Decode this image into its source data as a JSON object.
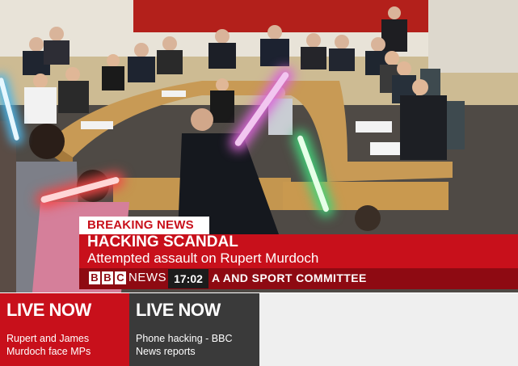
{
  "breaking": {
    "label": "BREAKING NEWS",
    "headline": "HACKING SCANDAL",
    "subline": "Attempted assault on Rupert Murdoch"
  },
  "ticker": {
    "brand_letters": [
      "B",
      "B",
      "C"
    ],
    "brand_word": "NEWS",
    "time": "17:02",
    "text": "A AND SPORT COMMITTEE"
  },
  "live_tiles": [
    {
      "title": "LIVE NOW",
      "description": "Rupert and James Murdoch face MPs"
    },
    {
      "title": "LIVE NOW",
      "description": "Phone hacking - BBC News reports"
    }
  ],
  "colors": {
    "bbc_red": "#c8101b",
    "bbc_dark_red": "#8e0a12",
    "tile_dark": "#3a3a3a"
  }
}
